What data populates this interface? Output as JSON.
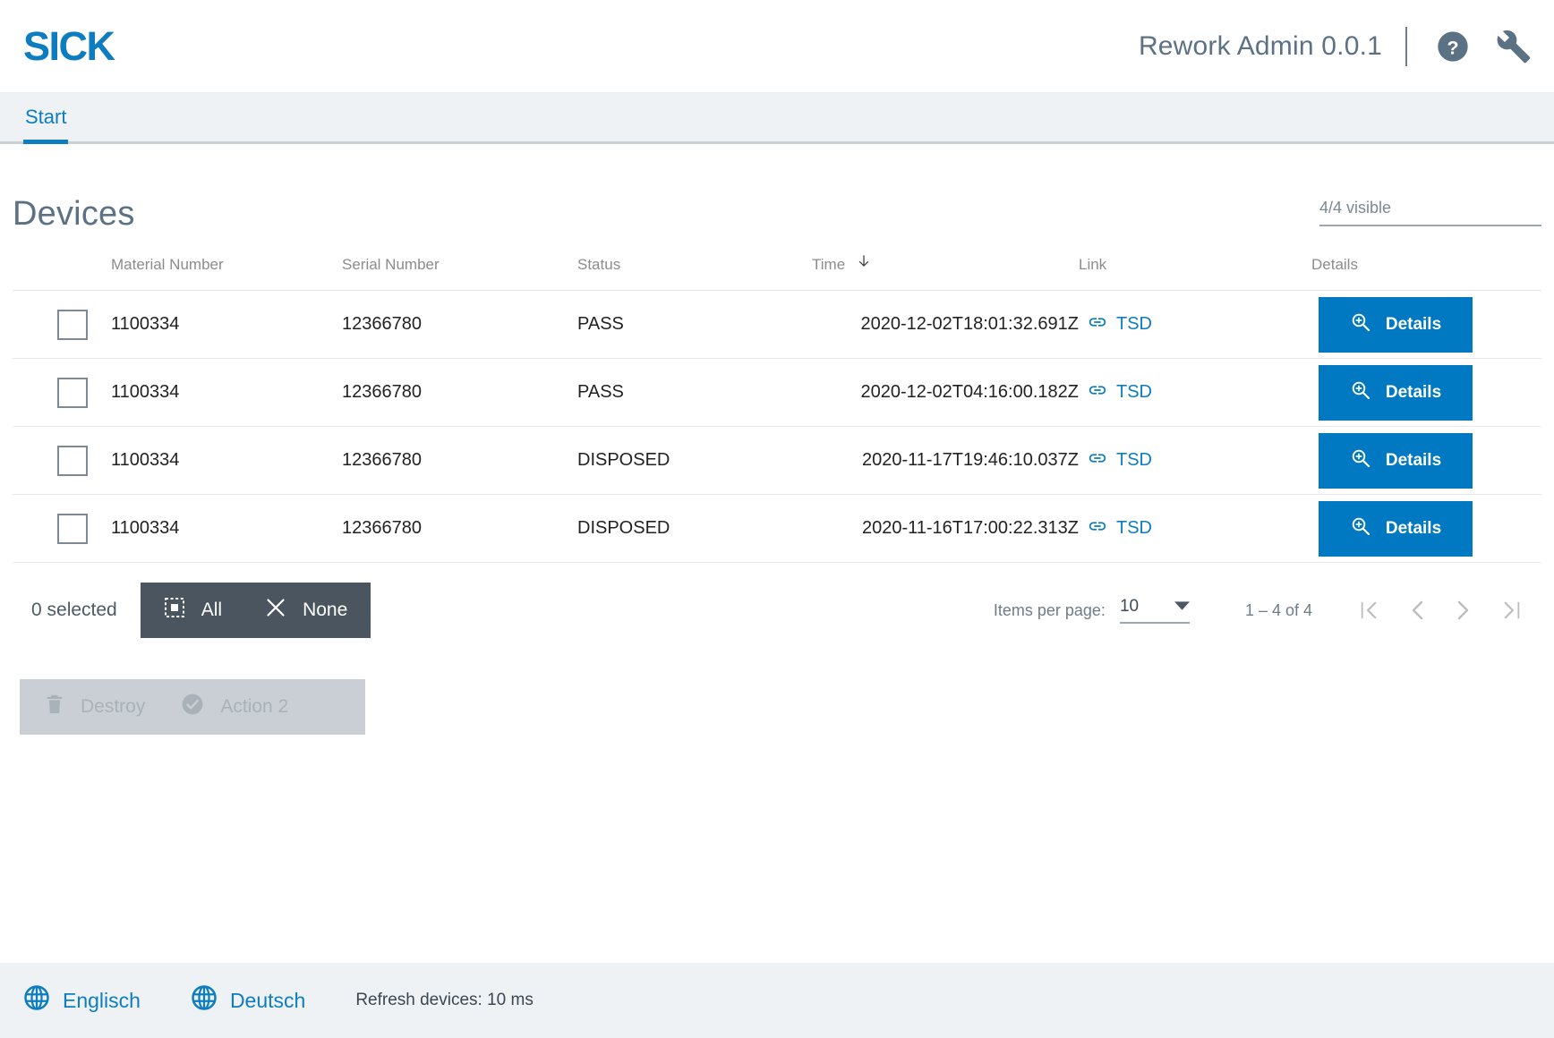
{
  "header": {
    "logo_text": "SICK",
    "app_title": "Rework Admin 0.0.1",
    "help_icon": "help-circle-icon",
    "tools_icon": "wrench-icon"
  },
  "tabs": [
    {
      "label": "Start",
      "active": true
    }
  ],
  "page": {
    "title": "Devices",
    "visible_count": "4/4 visible"
  },
  "table": {
    "columns": [
      {
        "key": "select",
        "label": ""
      },
      {
        "key": "material",
        "label": "Material Number"
      },
      {
        "key": "serial",
        "label": "Serial Number"
      },
      {
        "key": "status",
        "label": "Status"
      },
      {
        "key": "time",
        "label": "Time",
        "sort": "desc",
        "sort_icon": "arrow-down-icon"
      },
      {
        "key": "link",
        "label": "Link"
      },
      {
        "key": "details",
        "label": "Details"
      }
    ],
    "rows": [
      {
        "material": "1100334",
        "serial": "12366780",
        "status": "PASS",
        "time": "2020-12-02T18:01:32.691Z",
        "link_label": "TSD",
        "details_label": "Details",
        "checked": false
      },
      {
        "material": "1100334",
        "serial": "12366780",
        "status": "PASS",
        "time": "2020-12-02T04:16:00.182Z",
        "link_label": "TSD",
        "details_label": "Details",
        "checked": false
      },
      {
        "material": "1100334",
        "serial": "12366780",
        "status": "DISPOSED",
        "time": "2020-11-17T19:46:10.037Z",
        "link_label": "TSD",
        "details_label": "Details",
        "checked": false
      },
      {
        "material": "1100334",
        "serial": "12366780",
        "status": "DISPOSED",
        "time": "2020-11-16T17:00:22.313Z",
        "link_label": "TSD",
        "details_label": "Details",
        "checked": false
      }
    ]
  },
  "selection": {
    "count_label": "0 selected",
    "all_label": "All",
    "none_label": "None"
  },
  "paginator": {
    "items_per_page_label": "Items per page:",
    "items_per_page_value": "10",
    "range_label": "1 – 4 of 4",
    "first_icon": "first-page-icon",
    "prev_icon": "previous-page-icon",
    "next_icon": "next-page-icon",
    "last_icon": "last-page-icon"
  },
  "actions": {
    "destroy_label": "Destroy",
    "action2_label": "Action 2",
    "disabled": true
  },
  "footer": {
    "lang_english": "Englisch",
    "lang_german": "Deutsch",
    "refresh_text": "Refresh devices: 10 ms"
  },
  "colors": {
    "brand_blue": "#0d7dc0",
    "button_blue": "#0079c2",
    "tabbar_bg": "#eef2f4",
    "selection_bar": "#4a5560",
    "disabled_bar": "#c9cfd4",
    "title_gray": "#5b7184"
  }
}
